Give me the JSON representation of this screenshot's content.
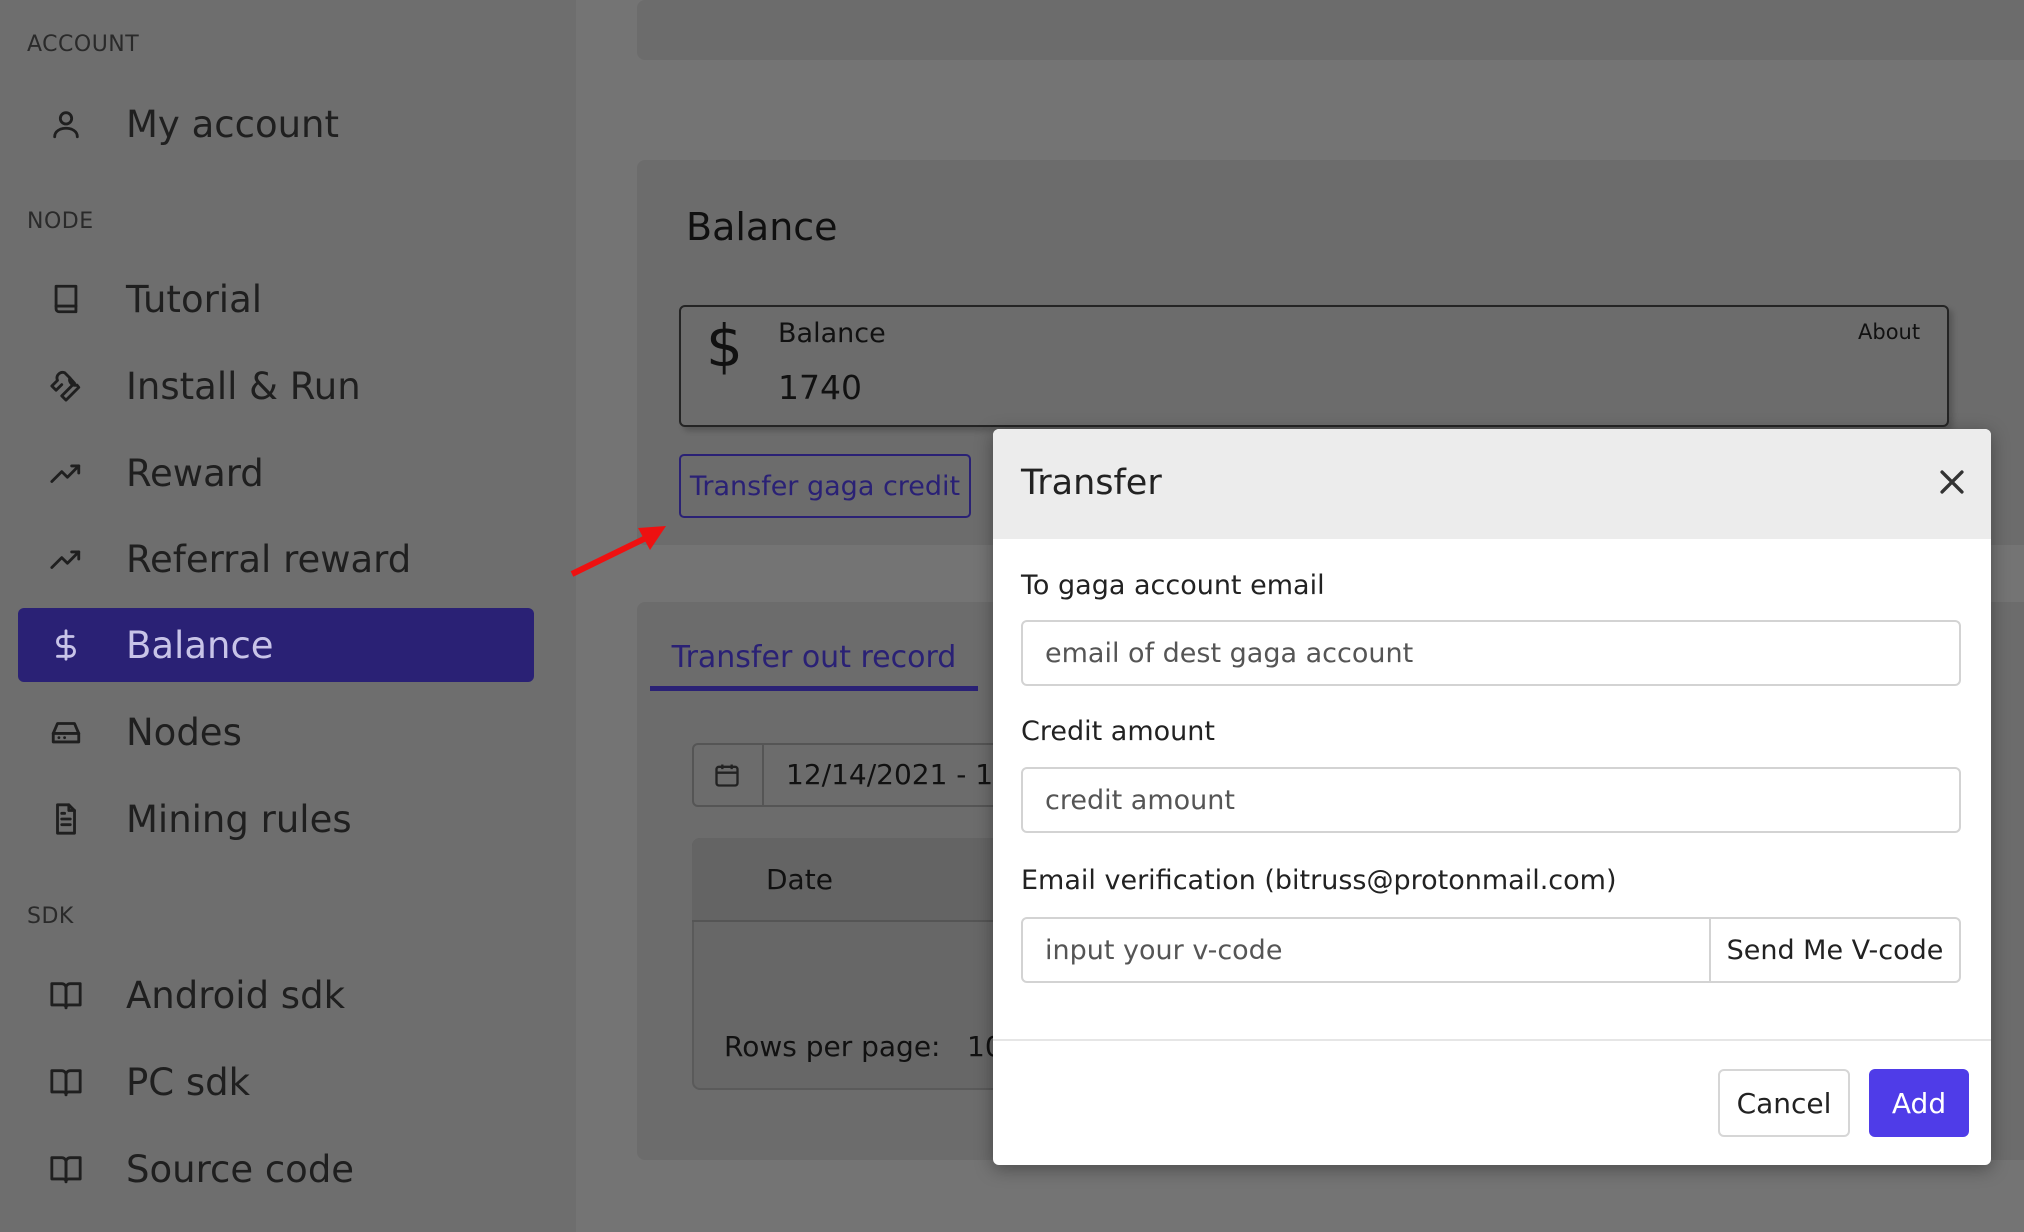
{
  "sidebar": {
    "sections": [
      {
        "label": "ACCOUNT",
        "items": [
          {
            "label": "My account",
            "icon": "user-icon"
          }
        ]
      },
      {
        "label": "NODE",
        "items": [
          {
            "label": "Tutorial",
            "icon": "book-icon"
          },
          {
            "label": "Install & Run",
            "icon": "wrench-icon"
          },
          {
            "label": "Reward",
            "icon": "trending-up-icon"
          },
          {
            "label": "Referral reward",
            "icon": "trending-up-icon"
          },
          {
            "label": "Balance",
            "icon": "dollar-icon",
            "active": true
          },
          {
            "label": "Nodes",
            "icon": "hard-drive-icon"
          },
          {
            "label": "Mining rules",
            "icon": "file-text-icon"
          }
        ]
      },
      {
        "label": "SDK",
        "items": [
          {
            "label": "Android sdk",
            "icon": "book-open-icon"
          },
          {
            "label": "PC sdk",
            "icon": "book-open-icon"
          },
          {
            "label": "Source code",
            "icon": "book-open-icon"
          }
        ]
      }
    ],
    "active_color": "#2a2175"
  },
  "balance": {
    "title": "Balance",
    "card_label": "Balance",
    "card_value": "1740",
    "about_label": "About",
    "currency_symbol": "$",
    "transfer_button": "Transfer gaga credit"
  },
  "records": {
    "tab_label": "Transfer out record",
    "date_range": "12/14/2021 - 12",
    "col_date": "Date",
    "rows_per_page_label": "Rows per page:",
    "rows_per_page_value": "10"
  },
  "modal": {
    "title": "Transfer",
    "email_label": "To gaga account email",
    "email_placeholder": "email of dest gaga account",
    "amount_label": "Credit amount",
    "amount_placeholder": "credit amount",
    "verify_label": "Email verification (bitruss@protonmail.com)",
    "verify_placeholder": "input your v-code",
    "send_button": "Send Me V-code",
    "cancel_button": "Cancel",
    "add_button": "Add",
    "accent_color": "#4f3ce8"
  }
}
